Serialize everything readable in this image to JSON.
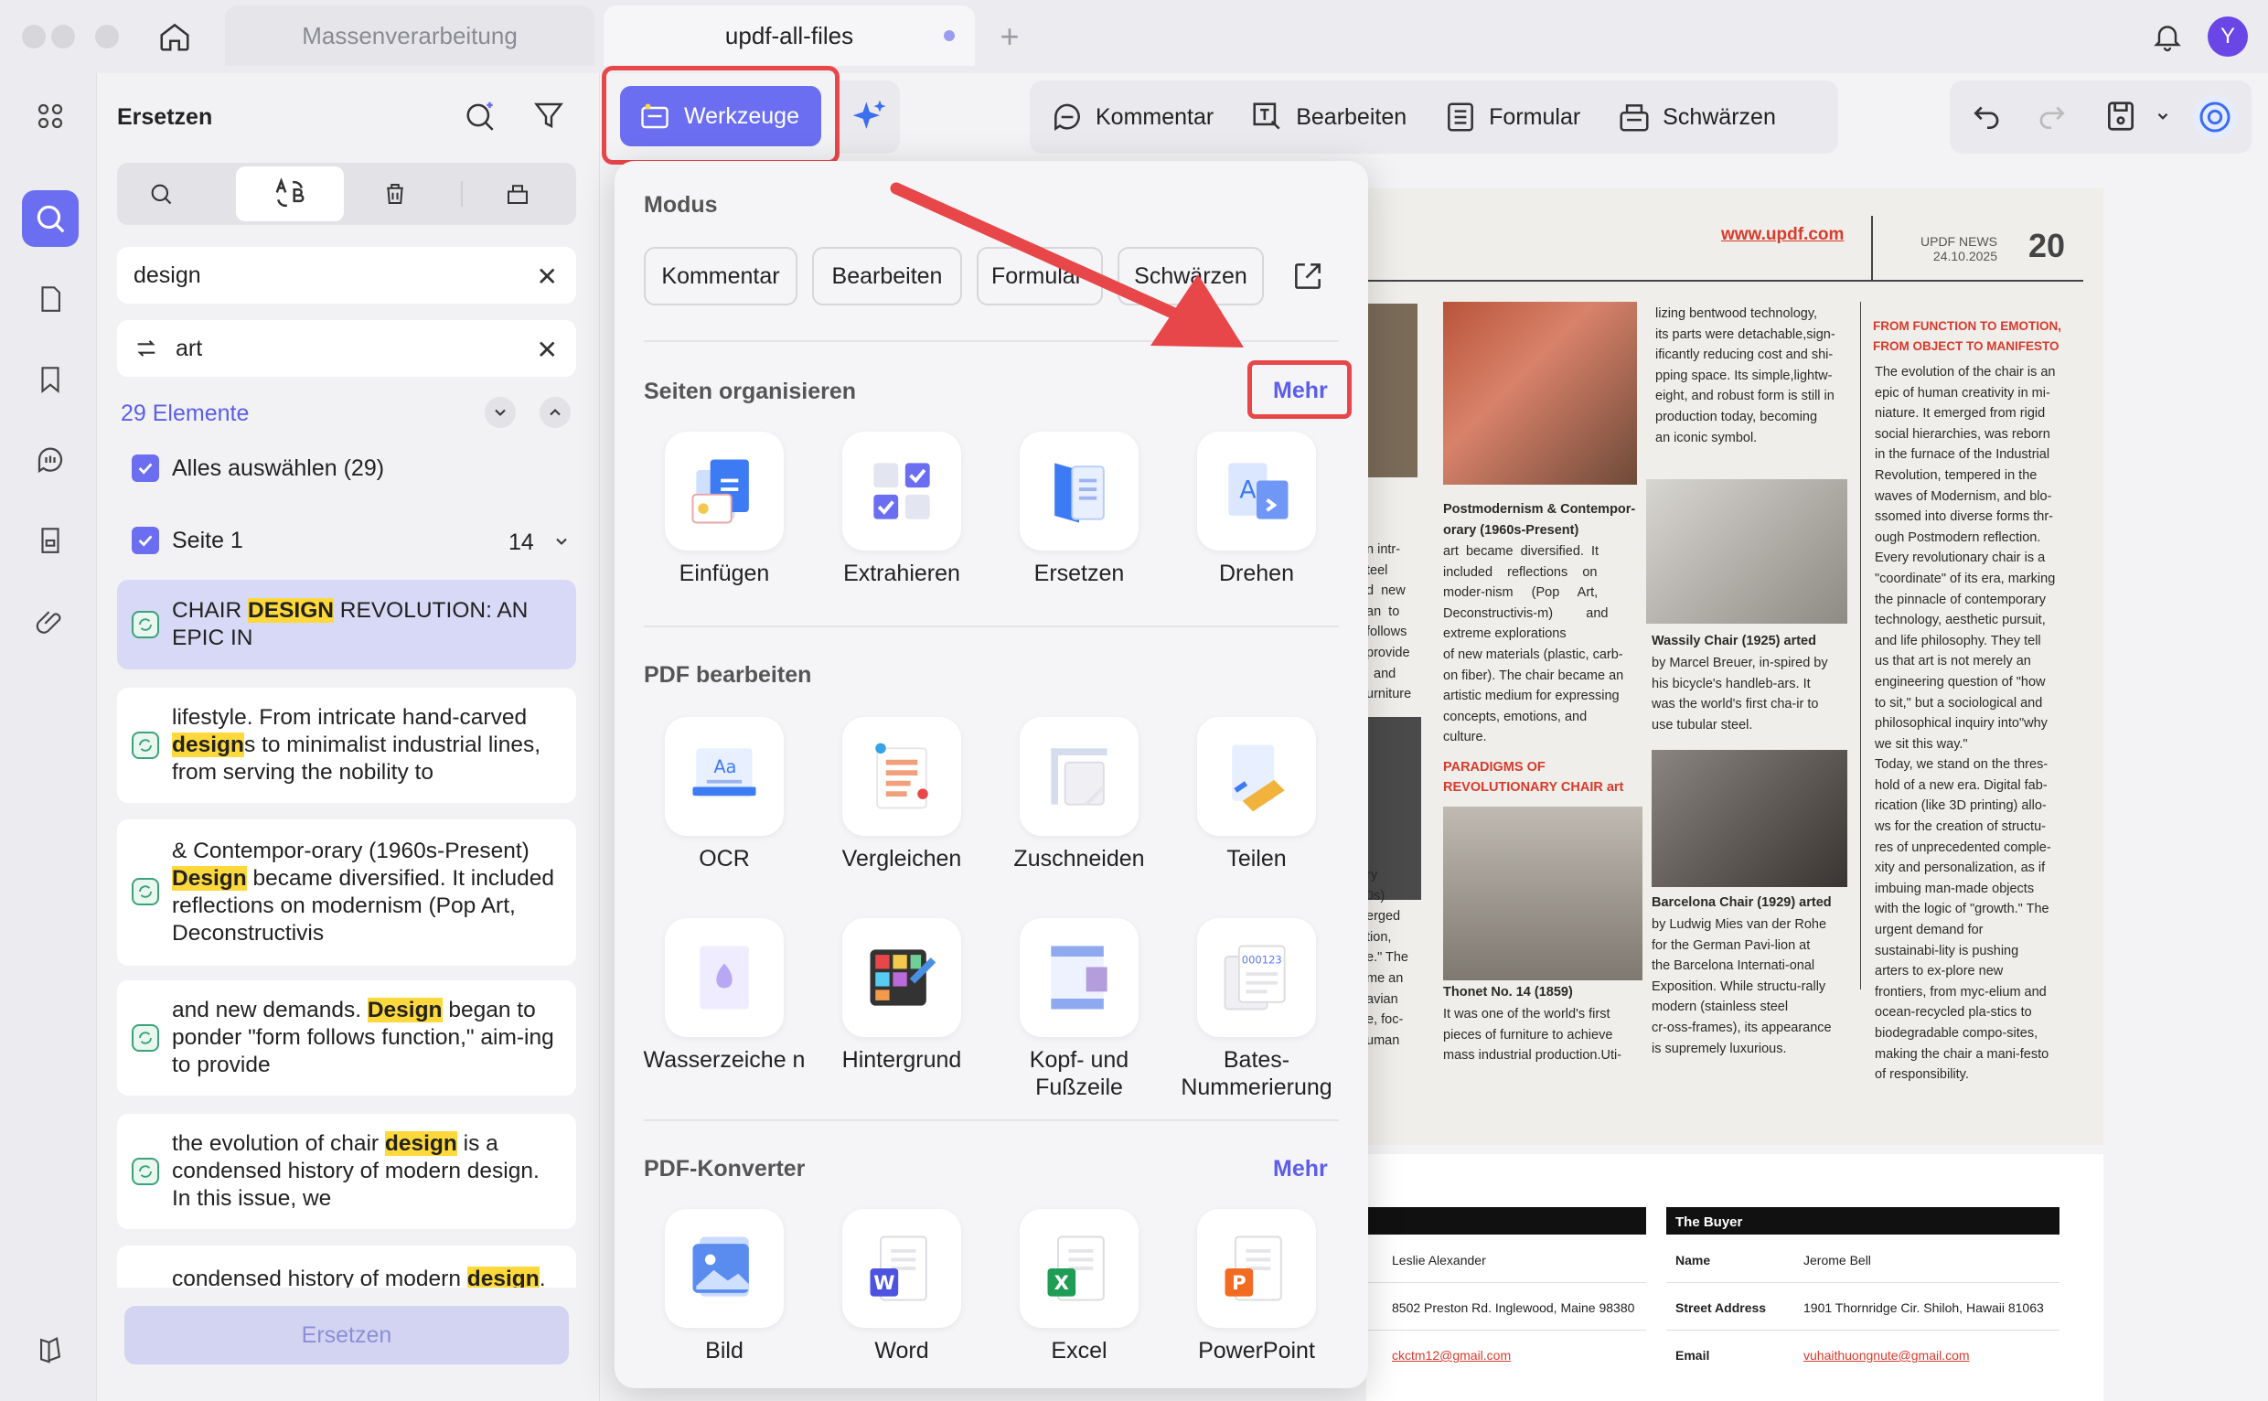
{
  "titlebar": {
    "tabs": [
      {
        "label": "Massenverarbeitung"
      },
      {
        "label": "updf-all-files"
      }
    ],
    "avatar": "Y"
  },
  "sidebar": {
    "title": "Ersetzen",
    "search_value": "design",
    "replace_value": "art",
    "count_label": "29 Elemente",
    "select_all": "Alles auswählen  (29)",
    "page_label": "Seite 1",
    "page_count": "14",
    "results": [
      {
        "pre": "CHAIR ",
        "hit": "DESIGN",
        "post": " REVOLUTION: AN EPIC IN"
      },
      {
        "pre": "lifestyle. From intricate hand-carved ",
        "hit": "design",
        "post": "s to minimalist industrial lines, from serving the nobility to"
      },
      {
        "pre": "& Contempor-orary (1960s-Present) ",
        "hit": "Design",
        "post": " became diversified. It included reflections on modernism (Pop Art, Deconstructivis"
      },
      {
        "pre": "and new demands. ",
        "hit": "Design",
        "post": " began to ponder \"form follows function,\" aim-ing to provide"
      },
      {
        "pre": "the evolution of chair ",
        "hit": "design",
        "post": " is a condensed history of modern design. In this issue, we"
      },
      {
        "pre": "condensed history of modern ",
        "hit": "design",
        "post": "."
      }
    ],
    "replace_button": "Ersetzen"
  },
  "toolbar": {
    "werkzeuge": "Werkzeuge",
    "kommentar": "Kommentar",
    "bearbeiten": "Bearbeiten",
    "formular": "Formular",
    "schwaerzen": "Schwärzen"
  },
  "menu": {
    "modus_title": "Modus",
    "modus": [
      "Kommentar",
      "Bearbeiten",
      "Formular",
      "Schwärzen"
    ],
    "organize_title": "Seiten organisieren",
    "organize_more": "Mehr",
    "organize": [
      "Einfügen",
      "Extrahieren",
      "Ersetzen",
      "Drehen"
    ],
    "edit_title": "PDF bearbeiten",
    "edit_row1": [
      "OCR",
      "Vergleichen",
      "Zuschneiden",
      "Teilen"
    ],
    "edit_row2": [
      "Wasserzeiche n",
      "Hintergrund",
      "Kopf- und Fußzeile",
      "Bates-Nummerierung"
    ],
    "convert_title": "PDF-Konverter",
    "convert_more": "Mehr",
    "convert": [
      "Bild",
      "Word",
      "Excel",
      "PowerPoint"
    ]
  },
  "doc": {
    "url": "www.updf.com",
    "news": "UPDF NEWS",
    "date": "24.10.2025",
    "page": "20",
    "col_mid_top": [
      "lizing bentwood technology,",
      "its parts were detachable,sign-",
      "ificantly reducing cost and shi-",
      "pping space. Its simple,lightw-",
      "eight, and robust form is still in",
      "production today, becoming",
      "an iconic symbol."
    ],
    "postmod_title": [
      "Postmodernism & Contempor-",
      "orary (1960s-Present)"
    ],
    "postmod": [
      "art  became  diversified.  It",
      "included    reflections    on",
      "moder-nism     (Pop     Art,",
      "Deconstructivis-m)         and",
      "extreme explorations",
      "of new materials (plastic, carb-",
      "on fiber). The chair became an",
      "artistic medium for expressing",
      "concepts, emotions, and",
      "culture."
    ],
    "paradigms": [
      "PARADIGMS OF",
      "REVOLUTIONARY CHAIR art"
    ],
    "thonet_title": "Thonet No. 14 (1859)",
    "thonet": [
      "It was one of the world's first",
      "pieces of furniture to achieve",
      "mass industrial production.Uti-"
    ],
    "wassily_title": "Wassily Chair (1925) arted",
    "wassily": [
      "by Marcel Breuer, in-spired by",
      "his bicycle's handleb-ars. It",
      "was the world's first cha-ir to",
      "use tubular steel."
    ],
    "barcelona_title": "Barcelona Chair (1929) arted",
    "barcelona": [
      "by Ludwig Mies van der Rohe",
      "for the German Pavi-lion at",
      "the Barcelona Internati-onal",
      "Exposition. While structu-rally",
      "modern (stainless steel",
      "cr-oss-frames), its appearance",
      "is supremely luxurious."
    ],
    "right_head": [
      "FROM FUNCTION TO EMOTION,",
      "FROM OBJECT TO MANIFESTO"
    ],
    "right": [
      "The evolution of the chair is an",
      "epic of human creativity in mi-",
      "niature. It emerged from rigid",
      "social hierarchies, was reborn",
      "in the furnace of the Industrial",
      "Revolution, tempered in the",
      "waves of Modernism, and blo-",
      "ssomed into diverse forms thr-",
      "ough Postmodern reflection.",
      "Every revolutionary chair is a",
      "\"coordinate\" of its era, marking",
      "the pinnacle of contemporary",
      "technology, aesthetic pursuit,",
      "and life philosophy. They tell",
      "us that art is not merely an",
      "engineering question of \"how",
      "to sit,\" but a sociological and",
      "philosophical inquiry into\"why",
      "we sit this way.\"",
      "Today, we stand on the thres-",
      "hold of a new era. Digital fab-",
      "rication (like 3D printing) allo-",
      "ws for the creation of structu-",
      "res of unprecedented comple-",
      "xity and personalization, as if",
      "imbuing man-made objects",
      "with the logic of \"growth.\" The",
      "urgent demand for",
      "sustainabi-lity is pushing",
      "arters to ex-plore new",
      "frontiers, from myc-elium and",
      "ocean-recycled pla-stics to",
      "biodegradable compo-sites,",
      "making the chair a mani-festo",
      "of responsibility."
    ],
    "left_frag": [
      "n intr-",
      "teel",
      "d  new",
      "an  to",
      "follows",
      "provide",
      "  and",
      "urniture"
    ],
    "left_frag2": [
      "ry",
      "0s)",
      "erged",
      "tion,",
      "e.\" The",
      "me an",
      "avian",
      "e, foc-",
      "uman"
    ],
    "buyer_head": "The Buyer",
    "seller": [
      "Leslie Alexander",
      "8502 Preston Rd. Inglewood, Maine 98380",
      "ckctm12@gmail.com"
    ],
    "buyer_rows": [
      [
        "Name",
        "Jerome Bell"
      ],
      [
        "Street Address",
        "1901 Thornridge Cir. Shiloh, Hawaii 81063"
      ],
      [
        "Email",
        "vuhaithuongnute@gmail.com"
      ]
    ]
  },
  "colors": {
    "accent": "#6b6ef0",
    "highlight": "#ffd93b",
    "annotation": "#e8474a"
  }
}
